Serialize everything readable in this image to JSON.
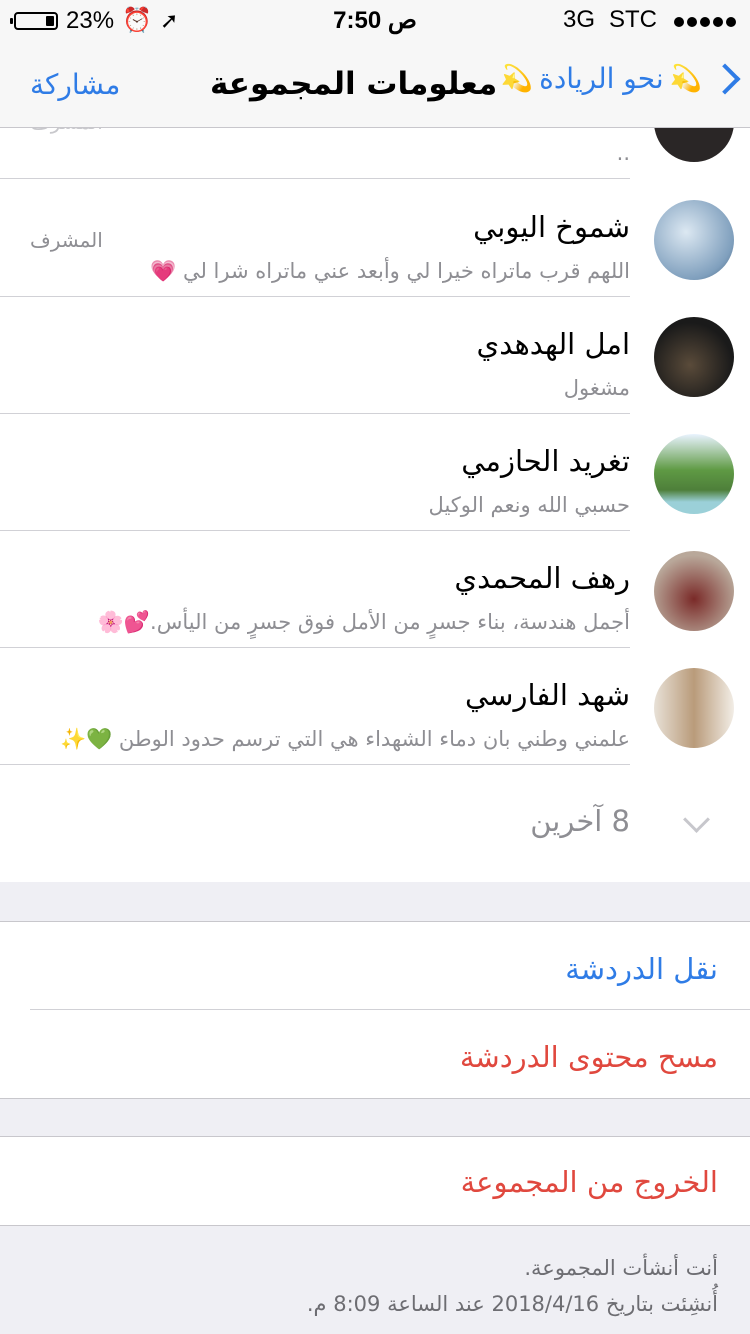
{
  "status_bar": {
    "battery_percent": "23%",
    "battery_level": 0.23,
    "time": "7:50",
    "ampm": "ص",
    "network": "3G",
    "carrier": "STC",
    "signal_bars": 5
  },
  "nav": {
    "back_label": "نحو الريادة",
    "title": "معلومات المجموعة",
    "share_label": "مشاركة"
  },
  "members": [
    {
      "name": "",
      "status": "..",
      "role": "المشرف",
      "avatar_color": "#2a2626"
    },
    {
      "name": "شموخ اليوبي",
      "status": "اللهم قرب ماتراه خيرا لي وأبعد عني ماتراه شرا لي 💗",
      "role": "المشرف",
      "avatar_color": "#9fb9cf"
    },
    {
      "name": "امل الهدهدي",
      "status": "مشغول",
      "role": "",
      "avatar_color": "#1f1f1f"
    },
    {
      "name": "تغريد الحازمي",
      "status": "حسبي الله ونعم الوكيل",
      "role": "",
      "avatar_color": "#6fa25a"
    },
    {
      "name": "رهف المحمدي",
      "status": "أجمل هندسة، بناء جسرٍ من الأمل فوق جسرٍ من اليأس.💕🌸",
      "role": "",
      "avatar_color": "#8a4a46"
    },
    {
      "name": "شهد الفارسي",
      "status": "علمني وطني بان دماء الشهداء هي التي ترسم حدود الوطن 💚✨",
      "role": "",
      "avatar_color": "#c9b79f"
    }
  ],
  "more_members": "8 آخرين",
  "actions": {
    "move_chat": "نقل الدردشة",
    "clear_chat": "مسح محتوى الدردشة",
    "exit_group": "الخروج من المجموعة"
  },
  "footer": {
    "line1": "أنت أنشأت المجموعة.",
    "line2": "أُنشِئت بتاريخ 2018/4/16 عند الساعة 8:09 م."
  }
}
